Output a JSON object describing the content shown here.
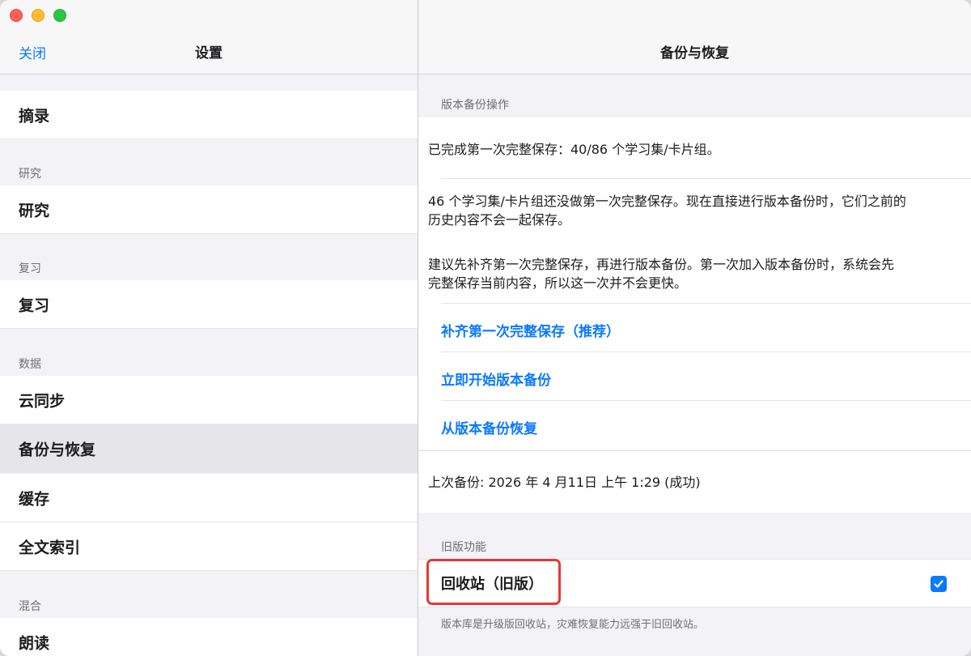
{
  "window": {
    "controls": [
      "close",
      "minimize",
      "zoom"
    ]
  },
  "sidebar": {
    "close_label": "关闭",
    "title": "设置",
    "rows": [
      {
        "label": "摘录"
      },
      {
        "section": "研究"
      },
      {
        "label": "研究"
      },
      {
        "section": "复习"
      },
      {
        "label": "复习"
      },
      {
        "section": "数据"
      },
      {
        "label": "云同步"
      },
      {
        "label": "备份与恢复",
        "selected": true
      },
      {
        "label": "缓存"
      },
      {
        "label": "全文索引"
      },
      {
        "section": "混合"
      },
      {
        "label": "朗读"
      }
    ]
  },
  "detail": {
    "title": "备份与恢复",
    "version_section": "版本备份操作",
    "status_line": "已完成第一次完整保存：40/86 个学习集/卡片组。",
    "warning_line1": "46 个学习集/卡片组还没做第一次完整保存。现在直接进行版本备份时，它们之前的",
    "warning_line2": "历史内容不会一起保存。",
    "advice_line1": "建议先补齐第一次完整保存，再进行版本备份。第一次加入版本备份时，系统会先",
    "advice_line2": "完整保存当前内容，所以这一次并不会更快。",
    "actions": {
      "fill_full_save": "补齐第一次完整保存（推荐）",
      "start_backup": "立即开始版本备份",
      "restore": "从版本备份恢复"
    },
    "last_backup": "上次备份: 2026 年 4 月11日 上午 1:29 (成功)",
    "legacy_section": "旧版功能",
    "legacy_item": {
      "label": "回收站（旧版）",
      "checked": true
    },
    "footnote": "版本库是升级版回收站，灾难恢复能力远强于旧回收站。"
  },
  "colors": {
    "accent": "#0a7aff",
    "highlight": "#e53935"
  },
  "icons": {
    "checkbox": "checkmark-icon"
  }
}
